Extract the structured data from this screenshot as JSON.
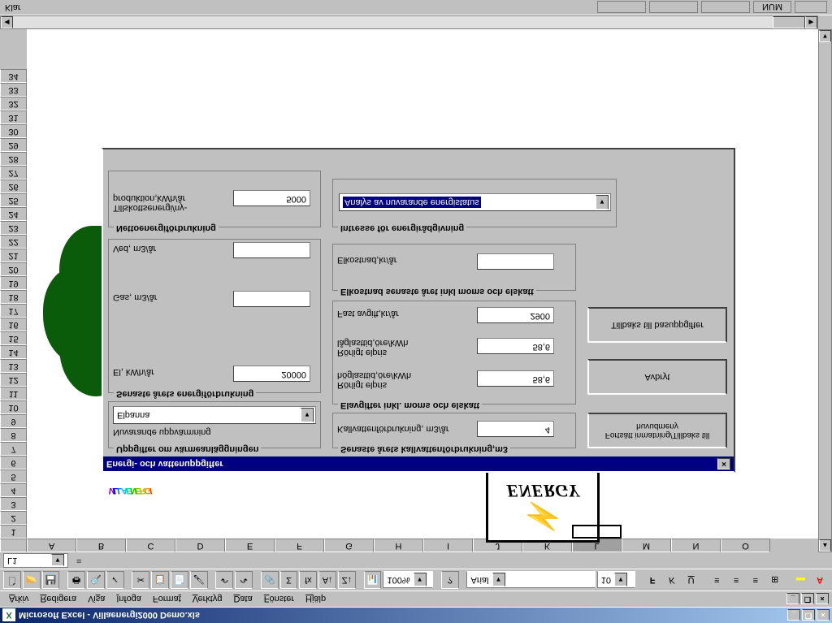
{
  "app": {
    "title": "Microsoft Excel - Villaenergi2000 Demo.xls",
    "status_ready": "Klar",
    "status_num": "NUM"
  },
  "menu": {
    "items": [
      "Arkiv",
      "Redigera",
      "Visa",
      "Infoga",
      "Format",
      "Verktyg",
      "Data",
      "Fönster",
      "Hjälp"
    ]
  },
  "toolbar": {
    "zoom": "100%",
    "font": "Arial",
    "fontsize": "10"
  },
  "formula": {
    "namebox": "L1",
    "eq": "="
  },
  "columns": [
    "A",
    "B",
    "C",
    "D",
    "E",
    "F",
    "G",
    "H",
    "I",
    "J",
    "K",
    "L",
    "M",
    "N",
    "O"
  ],
  "rows_start": 1,
  "rows_end": 34,
  "logo_text": "VILLAENERGI",
  "energy_badge": "ENERGY",
  "dialog": {
    "title": "Energi- och vattenuppgifter",
    "left": {
      "group1_title": "Uppgifter om värmeanläggningen",
      "heating_label": "Nuvarande uppvärmning",
      "heating_value": "Elpanna",
      "group2_title": "Senaste årets energiförbrukning",
      "el_label": "El, kWh/år",
      "el_value": "20000",
      "gas_label": "Gas, m3/år",
      "gas_value": "",
      "ved_label": "Ved, m3/år",
      "ved_value": "",
      "group3_title": "Nettoenergiförbrukning",
      "tillskott_label": "Tillskottsenergi/ny-\nproduktion,kWh/år",
      "tillskott_value": "5000"
    },
    "right": {
      "group1_title": "Senaste årets kallvattenförbrukning,m3",
      "kallvatten_label": "Kallvattenförbrukning, m3/år",
      "kallvatten_value": "4",
      "group2_title": "Elavgifter inkl. moms och elskatt",
      "hoglast_label": "Rörligt elpris\nhöglasttid,öre/kWh",
      "hoglast_value": "58,6",
      "laglast_label": "Rörligt elpris\nlåglasttid,öre/kWh",
      "laglast_value": "58,6",
      "fast_label": "Fast avgift,kr/år",
      "fast_value": "2900",
      "group3_title": "Elkostnad senaste året inkl moms och elskatt",
      "elkostnad_label": "Elkostnad,kr/år",
      "elkostnad_value": "",
      "group4_title": "Intresse för energirådgivning",
      "intresse_value": "Analys av nuvarande energistatus"
    },
    "buttons": {
      "fortsatt": "Fortsätt inmatning/Tillbaks till huvudmeny",
      "avbryt": "Avbryt",
      "tillbaks": "Tillbaks till basuppgifter"
    }
  }
}
